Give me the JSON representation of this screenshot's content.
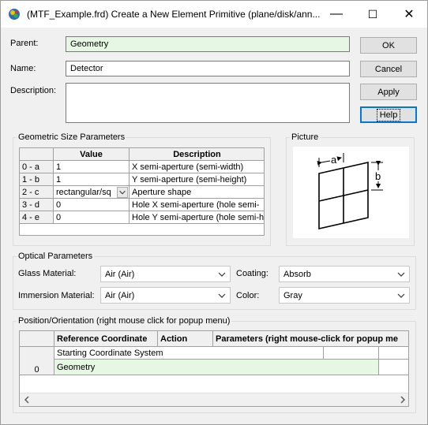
{
  "window": {
    "title": "(MTF_Example.frd) Create a New Element Primitive (plane/disk/ann...",
    "minimize_glyph": "—",
    "maximize_glyph": "☐",
    "close_glyph": "✕"
  },
  "form": {
    "parent_label": "Parent:",
    "parent_value": "Geometry",
    "name_label": "Name:",
    "name_value": "Detector",
    "description_label": "Description:",
    "description_value": ""
  },
  "buttons": {
    "ok": "OK",
    "cancel": "Cancel",
    "apply": "Apply",
    "help": "Help"
  },
  "geometric": {
    "title": "Geometric Size Parameters",
    "col_value": "Value",
    "col_description": "Description",
    "rows": [
      {
        "id": "0 - a",
        "value": "1",
        "description": "X semi-aperture (semi-width)"
      },
      {
        "id": "1 - b",
        "value": "1",
        "description": "Y semi-aperture (semi-height)"
      },
      {
        "id": "2 - c",
        "value": "rectangular/sq",
        "description": "Aperture shape"
      },
      {
        "id": "3 - d",
        "value": "0",
        "description": "Hole X semi-aperture (hole semi-"
      },
      {
        "id": "4 - e",
        "value": "0",
        "description": "Hole Y semi-aperture (hole semi-h"
      }
    ]
  },
  "picture": {
    "title": "Picture",
    "label_a": "a",
    "label_b": "b"
  },
  "optical": {
    "title": "Optical Parameters",
    "glass_label": "Glass Material:",
    "glass_value": "Air   (Air)",
    "coating_label": "Coating:",
    "coating_value": "Absorb",
    "immersion_label": "Immersion Material:",
    "immersion_value": "Air   (Air)",
    "color_label": "Color:",
    "color_value": "Gray"
  },
  "position": {
    "title": "Position/Orientation  (right mouse click for popup menu)",
    "col_ref": "Reference Coordinate",
    "col_action": "Action",
    "col_params": "Parameters (right mouse-click for popup me",
    "row_system": "Starting Coordinate System",
    "row_index": "0",
    "row_value": "Geometry"
  },
  "icons": [
    "app-icon",
    "minimize-icon",
    "maximize-icon",
    "close-icon",
    "dropdown-arrow-icon",
    "chevron-down-icon",
    "scroll-left-icon",
    "scroll-right-icon"
  ],
  "colors": {
    "field_green": "#e6f8e3",
    "focus_blue": "#0078d7",
    "dialog_bg": "#f0f0f0"
  }
}
